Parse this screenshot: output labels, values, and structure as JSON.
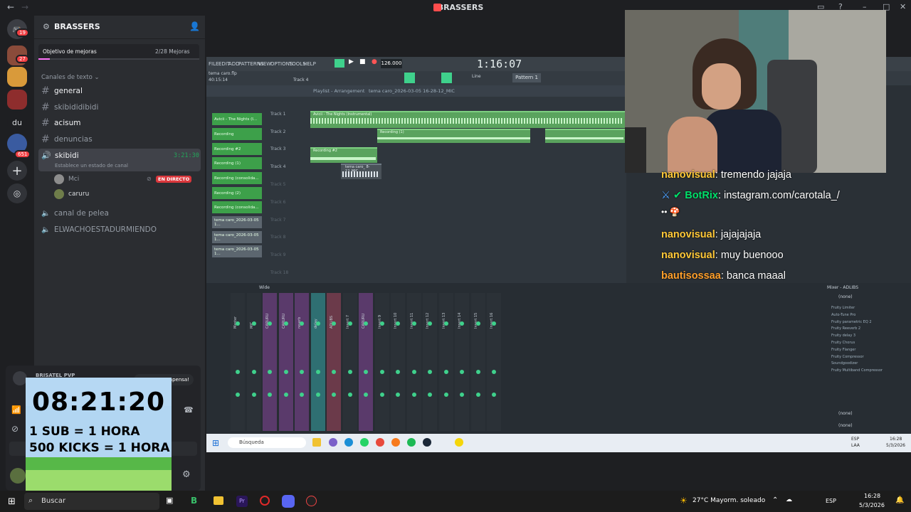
{
  "window": {
    "title": "BRASSERS"
  },
  "rail": {
    "badges": [
      "19",
      "27",
      "651"
    ],
    "text_server": "du"
  },
  "sidebar": {
    "server_name": "BRASSERS",
    "boost": {
      "label": "Objetivo de mejoras",
      "progress": "2/28 Mejoras",
      "fraction": 0.07
    },
    "category": "Canales de texto",
    "text_channels": [
      "general",
      "skibididibidi",
      "acisum",
      "denuncias"
    ],
    "voice_channel": {
      "name": "skibidi",
      "time": "3:21:30",
      "status": "Establece un estado de canal"
    },
    "voice_users": [
      {
        "name": "Mci",
        "live_label": "EN DIRECTO"
      },
      {
        "name": "caruru"
      }
    ],
    "other_channels": [
      "canal de pelea",
      "ELWACHOESTADURMIENDO"
    ]
  },
  "voicepanel": {
    "connected": "BRISATEL PVP",
    "compensa": "Compensa!"
  },
  "timer": {
    "time": "08:21:20",
    "line1": "1 SUB = 1 HORA",
    "line2": "500 KICKS = 1 HORA"
  },
  "fl": {
    "menu": [
      "FILE",
      "EDIT",
      "ADD",
      "PATTERNS",
      "VIEW",
      "OPTIONS",
      "TOOLS",
      "HELP"
    ],
    "tempo": "126.000",
    "time": "1:16:07",
    "project": "tema caro.flp",
    "position": "40:15:14",
    "hint": "Track 4",
    "pattern": "Pattern 1",
    "line_mode": "Line",
    "playlist_title": "Playlist - Arrangement",
    "playlist_file": "tema caro_2026-03-05 16-28-12_MIC",
    "tracks": [
      "Track 1",
      "Track 2",
      "Track 3",
      "Track 4",
      "Track 5",
      "Track 6",
      "Track 7",
      "Track 8",
      "Track 9",
      "Track 18"
    ],
    "channels": [
      "Avicii - The Nights (I...",
      "Recording",
      "Recording #2",
      "Recording (1)",
      "Recording (consolida...",
      "Recording (2)",
      "Recording (consolida...",
      "tema caro_2026-03-05 1...",
      "tema caro_2026-03-05 1...",
      "tema caro_2026-03-05 1..."
    ],
    "clips": {
      "avicii": "Avicii - The Nights (Instrumental)",
      "recording1": "Recording (1)",
      "recording": "Recording",
      "recording2": "Recording #2",
      "mic": "tema caro_ 8-12_MIC"
    },
    "mixer_title": "Mixer - ADLIBS",
    "mixer_mode": "Wide",
    "mixer_none": "(none)",
    "mixer_strips": [
      "Master",
      "MIC",
      "CARURU",
      "CARURU",
      "reverb",
      "delay",
      "ADLIBS",
      "Insert 7",
      "CARURU",
      "Insert 9",
      "Insert 10",
      "Insert 11",
      "Insert 12",
      "Insert 13",
      "Insert 14",
      "Insert 15",
      "Insert 16"
    ],
    "fx_slots": [
      "Fruity Limiter",
      "Auto-Tune Pro",
      "Fruity parametric EQ 2",
      "Fruity Reeverb 2",
      "Fruity delay 3",
      "Fruity Chorus",
      "Fruity Flanger",
      "Fruity Compressor",
      "Soundgoodizer",
      "Fruity Multiband Compressor"
    ],
    "taskbar_search": "Búsqueda",
    "taskbar_lang": "ESP",
    "taskbar_lang2": "LAA",
    "taskbar_time": "16:28",
    "taskbar_date": "5/3/2026"
  },
  "chat": [
    {
      "user": "nanovisual",
      "text": "tremendo jajaja",
      "color": "#ffc838"
    },
    {
      "user": "BotRix",
      "text": "instagram.com/carotala_/",
      "color": "#00e06a"
    },
    {
      "user": "",
      "text": "•• 🍄",
      "color": "#ffffff"
    },
    {
      "user": "nanovisual",
      "text": "jajajajaja",
      "color": "#ffc838"
    },
    {
      "user": "nanovisual",
      "text": "muy buenooo",
      "color": "#ffc838"
    },
    {
      "user": "bautisossaa",
      "text": "banca maaal",
      "color": "#ff9f2a"
    }
  ],
  "taskbar": {
    "search": "Buscar",
    "weather": "27°C  Mayorm. soleado",
    "lang": "ESP",
    "time": "16:28",
    "date": "5/3/2026"
  },
  "colors": {
    "discord_bg": "#2b2d31",
    "rail_bg": "#1e1f22",
    "live_red": "#da373c",
    "fl_green": "#3fd18c",
    "timer_text": "#000000"
  }
}
